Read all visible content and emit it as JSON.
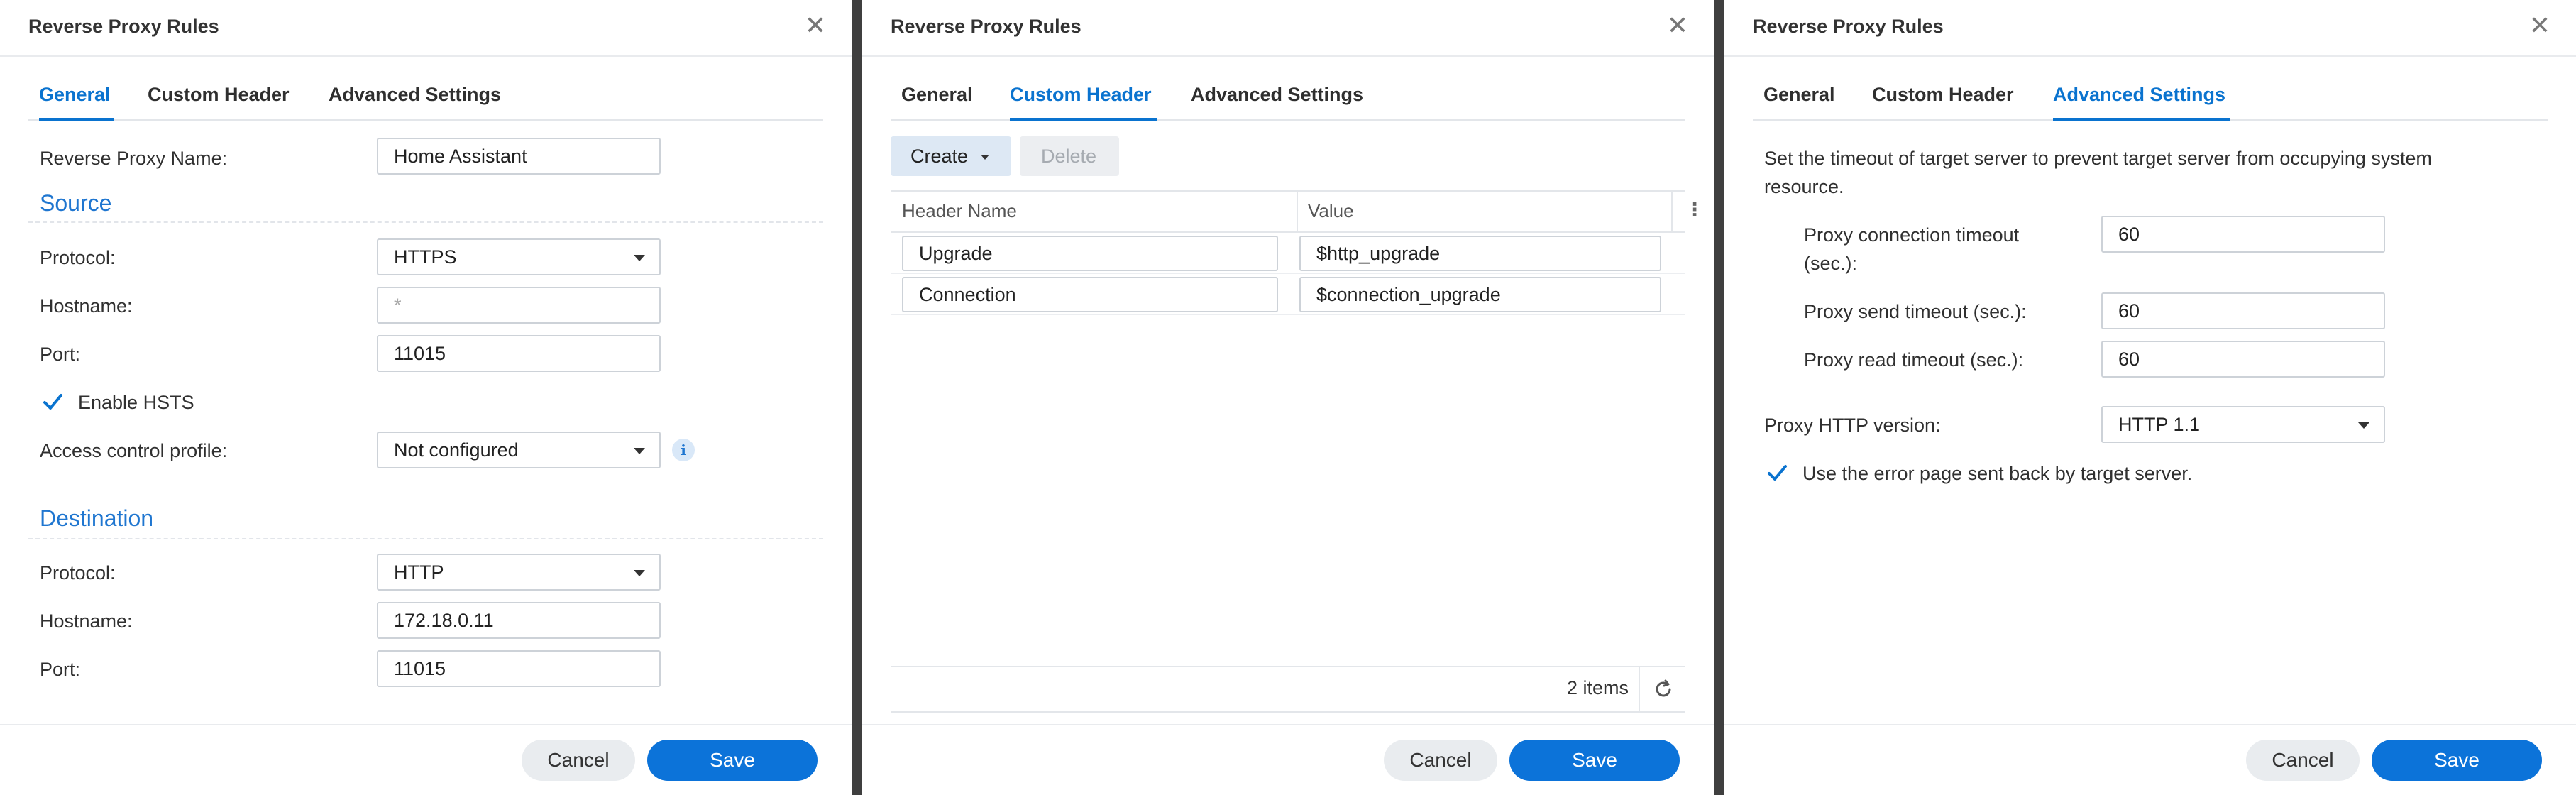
{
  "dialogs": [
    {
      "title": "Reverse Proxy Rules",
      "tabs": [
        "General",
        "Custom Header",
        "Advanced Settings"
      ],
      "general": {
        "name_label": "Reverse Proxy Name:",
        "name_value": "Home Assistant",
        "source_title": "Source",
        "protocol_label": "Protocol:",
        "src_protocol": "HTTPS",
        "hostname_label": "Hostname:",
        "src_hostname_placeholder": "*",
        "port_label": "Port:",
        "src_port": "11015",
        "hsts_label": "Enable HSTS",
        "acl_label": "Access control profile:",
        "acl_value": "Not configured",
        "dest_title": "Destination",
        "dst_protocol": "HTTP",
        "dst_hostname": "172.18.0.11",
        "dst_port": "11015"
      },
      "cancel": "Cancel",
      "save": "Save"
    },
    {
      "title": "Reverse Proxy Rules",
      "tabs": [
        "General",
        "Custom Header",
        "Advanced Settings"
      ],
      "toolbar": {
        "create": "Create",
        "delete": "Delete"
      },
      "columns": [
        "Header Name",
        "Value"
      ],
      "rows": [
        {
          "name": "Upgrade",
          "value": "$http_upgrade"
        },
        {
          "name": "Connection",
          "value": "$connection_upgrade"
        }
      ],
      "item_count": "2 items",
      "cancel": "Cancel",
      "save": "Save"
    },
    {
      "title": "Reverse Proxy Rules",
      "tabs": [
        "General",
        "Custom Header",
        "Advanced Settings"
      ],
      "advanced": {
        "desc_line1": "Set the timeout of target server to prevent target server from occupying system",
        "desc_line2": "resource.",
        "conn_label_1": "Proxy connection timeout",
        "conn_label_2": "(sec.):",
        "conn_value": "60",
        "send_label": "Proxy send timeout (sec.):",
        "send_value": "60",
        "read_label": "Proxy read timeout (sec.):",
        "read_value": "60",
        "http_version_label": "Proxy HTTP version:",
        "http_version_value": "HTTP 1.1",
        "error_page_label": "Use the error page sent back by target server."
      },
      "cancel": "Cancel",
      "save": "Save"
    }
  ],
  "colors": {
    "accent": "#0a73cf",
    "save_button": "#0c73d9",
    "backdrop": "#3f3f3f"
  }
}
